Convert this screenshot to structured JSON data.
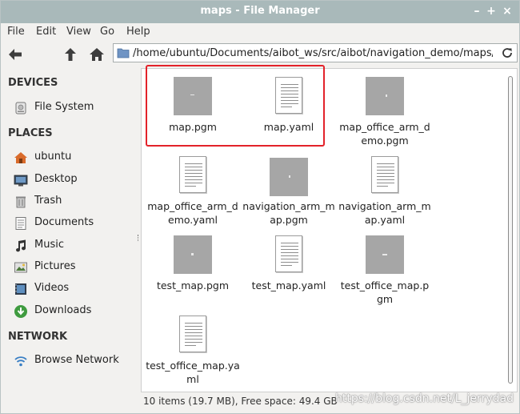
{
  "window": {
    "title": "maps - File Manager",
    "controls": {
      "minimize": "–",
      "maximize": "+",
      "close": "×"
    }
  },
  "menu": [
    "File",
    "Edit",
    "View",
    "Go",
    "Help"
  ],
  "toolbar": {
    "back_icon": "arrow-left-icon",
    "up_icon": "arrow-up-icon",
    "home_icon": "home-icon",
    "path": "/home/ubuntu/Documents/aibot_ws/src/aibot/navigation_demo/maps/",
    "reload_icon": "reload-icon"
  },
  "sidebar": {
    "devices_title": "DEVICES",
    "devices": [
      {
        "label": "File System",
        "icon": "drive-icon"
      }
    ],
    "places_title": "PLACES",
    "places": [
      {
        "label": "ubuntu",
        "icon": "home-icon"
      },
      {
        "label": "Desktop",
        "icon": "desktop-icon"
      },
      {
        "label": "Trash",
        "icon": "trash-icon"
      },
      {
        "label": "Documents",
        "icon": "documents-icon"
      },
      {
        "label": "Music",
        "icon": "music-icon"
      },
      {
        "label": "Pictures",
        "icon": "pictures-icon"
      },
      {
        "label": "Videos",
        "icon": "videos-icon"
      },
      {
        "label": "Downloads",
        "icon": "downloads-icon"
      }
    ],
    "network_title": "NETWORK",
    "network": [
      {
        "label": "Browse Network",
        "icon": "network-icon"
      }
    ]
  },
  "files": [
    {
      "name": "map.pgm",
      "type": "pgm"
    },
    {
      "name": "map.yaml",
      "type": "yaml"
    },
    {
      "name": "map_office_arm_demo.pgm",
      "type": "pgm"
    },
    {
      "name": "map_office_arm_demo.yaml",
      "type": "yaml"
    },
    {
      "name": "navigation_arm_map.pgm",
      "type": "pgm"
    },
    {
      "name": "navigation_arm_map.yaml",
      "type": "yaml"
    },
    {
      "name": "test_map.pgm",
      "type": "pgm"
    },
    {
      "name": "test_map.yaml",
      "type": "yaml"
    },
    {
      "name": "test_office_map.pgm",
      "type": "pgm"
    },
    {
      "name": "test_office_map.yaml",
      "type": "yaml"
    }
  ],
  "status": "10 items (19.7 MB), Free space: 49.4 GB",
  "watermark": "https://blog.csdn.net/L_jerrydad",
  "colors": {
    "titlebar": "#a9b9ba",
    "highlight_box": "#e3222a",
    "thumbnail_gray": "#a6a6a6"
  }
}
